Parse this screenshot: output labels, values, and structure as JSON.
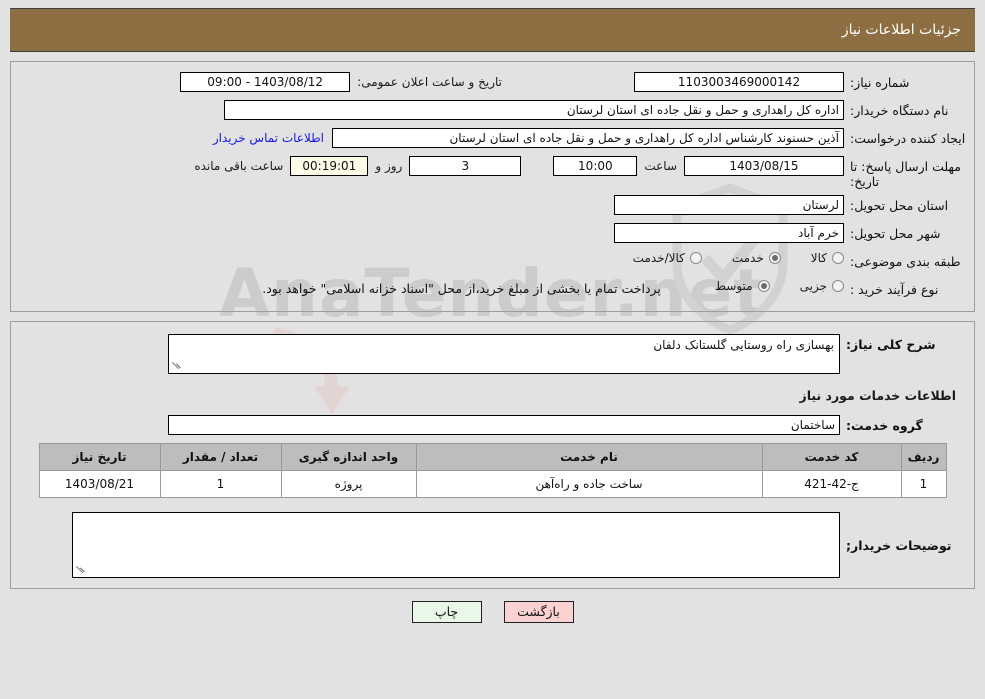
{
  "header": {
    "title": "جزئیات اطلاعات نیاز"
  },
  "fields": {
    "need_number_label": "شماره نیاز:",
    "need_number_value": "1103003469000142",
    "announce_label": "تاریخ و ساعت اعلان عمومی:",
    "announce_value": "1403/08/12 - 09:00",
    "buyer_org_label": "نام دستگاه خریدار:",
    "buyer_org_value": "اداره کل راهداری و حمل و نقل جاده ای استان لرستان",
    "creator_label": "ایجاد کننده درخواست:",
    "creator_value": "آذین حسنوند کارشناس اداره کل راهداری و حمل و نقل جاده ای استان لرستان",
    "contact_link": "اطلاعات تماس خریدار",
    "deadline_label": "مهلت ارسال پاسخ: تا تاریخ:",
    "deadline_date": "1403/08/15",
    "deadline_hour_label": "ساعت",
    "deadline_hour": "10:00",
    "remaining_days": "3",
    "remaining_days_label": "روز و",
    "remaining_time": "00:19:01",
    "remaining_suffix": "ساعت باقی مانده",
    "province_label": "استان محل تحویل:",
    "province_value": "لرستان",
    "city_label": "شهر محل تحویل:",
    "city_value": "خرم آباد",
    "category_label": "طبقه بندی موضوعی:",
    "process_label": "نوع فرآیند خرید :",
    "purchase_note": "پرداخت تمام یا بخشی از مبلغ خرید،از محل \"اسناد خزانه اسلامی\" خواهد بود."
  },
  "category_options": [
    {
      "label": "کالا",
      "selected": false
    },
    {
      "label": "خدمت",
      "selected": true
    },
    {
      "label": "کالا/خدمت",
      "selected": false
    }
  ],
  "process_options": [
    {
      "label": "جزیی",
      "selected": false
    },
    {
      "label": "متوسط",
      "selected": true
    }
  ],
  "summary": {
    "label": "شرح کلی نیاز:",
    "value": "بهسازی راه روستایی  گلستانک دلفان"
  },
  "services_section": {
    "title": "اطلاعات خدمات مورد نیاز",
    "group_label": "گروه خدمت:",
    "group_value": "ساختمان"
  },
  "table": {
    "headers": [
      "ردیف",
      "کد خدمت",
      "نام خدمت",
      "واحد اندازه گیری",
      "تعداد / مقدار",
      "تاریخ نیاز"
    ],
    "rows": [
      [
        "1",
        "ج-42-421",
        "ساخت جاده و راه‌آهن",
        "پروژه",
        "1",
        "1403/08/21"
      ]
    ]
  },
  "buyer_notes": {
    "label": "توضیحات خریدار;",
    "value": ""
  },
  "buttons": {
    "print": "چاپ",
    "back": "بازگشت"
  },
  "watermark": {
    "text": "AnaTender.net"
  },
  "colors": {
    "header_bg": "#8d6e42",
    "page_bg": "#e2e2e2",
    "link": "#1717e0",
    "print_btn": "#e9f7e9",
    "back_btn": "#fbd2d2"
  }
}
